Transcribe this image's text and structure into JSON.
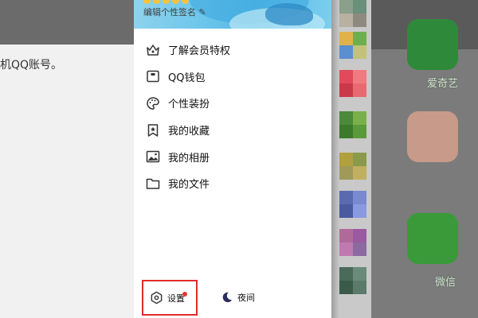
{
  "background_article": {
    "text": "机QQ账号。"
  },
  "drawer": {
    "signature_label": "编辑个性签名",
    "menu": [
      {
        "label": "了解会员特权",
        "icon": "crown-icon"
      },
      {
        "label": "QQ钱包",
        "icon": "wallet-icon"
      },
      {
        "label": "个性装扮",
        "icon": "palette-icon"
      },
      {
        "label": "我的收藏",
        "icon": "bookmark-star-icon"
      },
      {
        "label": "我的相册",
        "icon": "photo-album-icon"
      },
      {
        "label": "我的文件",
        "icon": "folder-icon"
      }
    ],
    "bottom": {
      "settings_label": "设置",
      "night_label": "夜间"
    }
  },
  "home_screen": {
    "apps": [
      {
        "label": "爱奇艺",
        "icon": "iqiyi-icon"
      },
      {
        "label": "微信",
        "icon": "wechat-icon"
      }
    ]
  },
  "colors": {
    "highlight_box": "#e02b2b",
    "notification_dot": "#e8362b",
    "header_blue": "#54b8e6"
  }
}
